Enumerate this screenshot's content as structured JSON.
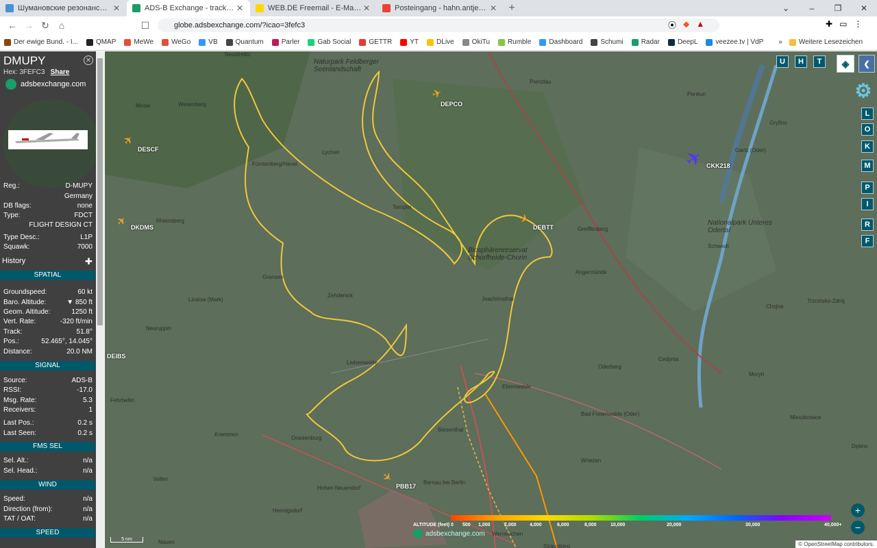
{
  "tabs": [
    {
      "title": "Шумановские резонансы | Space Ob",
      "active": false,
      "fav": "#4a90d9"
    },
    {
      "title": "ADS-B Exchange - tracking 11435",
      "active": true,
      "fav": "#1a9c6b"
    },
    {
      "title": "WEB.DE Freemail - E-Mail made in Ge",
      "active": false,
      "fav": "#ffd700"
    },
    {
      "title": "Posteingang - hahn.antje73@gmail.cc",
      "active": false,
      "fav": "#ea4335"
    }
  ],
  "url": "globe.adsbexchange.com/?icao=3fefc3",
  "bookmarks": [
    {
      "label": "Der ewige Bund. - I...",
      "color": "#8b4513"
    },
    {
      "label": "QMAP",
      "color": "#222"
    },
    {
      "label": "MeWe",
      "color": "#e74c3c"
    },
    {
      "label": "WeGo",
      "color": "#e74c3c"
    },
    {
      "label": "VB",
      "color": "#3399ff"
    },
    {
      "label": "Quantum",
      "color": "#444"
    },
    {
      "label": "Parler",
      "color": "#c2185b"
    },
    {
      "label": "Gab Social",
      "color": "#21cf7a"
    },
    {
      "label": "GETTR",
      "color": "#e53935"
    },
    {
      "label": "YT",
      "color": "#ff0000"
    },
    {
      "label": "DLive",
      "color": "#ffc107"
    },
    {
      "label": "OkiTu",
      "color": "#888"
    },
    {
      "label": "Rumble",
      "color": "#85c742"
    },
    {
      "label": "Dashboard",
      "color": "#3399ff"
    },
    {
      "label": "Schumi",
      "color": "#444"
    },
    {
      "label": "Radar",
      "color": "#1a9c6b"
    },
    {
      "label": "DeepL",
      "color": "#0f2b46"
    },
    {
      "label": "veezee.tv | VdP",
      "color": "#1e88e5"
    }
  ],
  "more_bookmarks": "Weitere Lesezeichen",
  "aircraft": {
    "callsign": "DMUPY",
    "hex_label": "Hex:",
    "hex": "3FEFC3",
    "share": "Share",
    "brand": "adsbexchange.com"
  },
  "info": [
    {
      "k": "Reg.:",
      "v": "D-MUPY"
    },
    {
      "k": "",
      "v": "Germany"
    },
    {
      "k": "DB flags:",
      "v": "none"
    },
    {
      "k": "Type:",
      "v": "FDCT"
    },
    {
      "k": "",
      "v": "FLIGHT DESIGN CT"
    },
    {
      "k": "Type Desc.:",
      "v": "L1P"
    },
    {
      "k": "Squawk:",
      "v": "7000"
    }
  ],
  "history_label": "History",
  "sections": {
    "spatial": {
      "title": "SPATIAL",
      "rows": [
        {
          "k": "Groundspeed:",
          "v": "60 kt"
        },
        {
          "k": "Baro. Altitude:",
          "v": "▼ 850 ft"
        },
        {
          "k": "Geom. Altitude:",
          "v": "1250 ft"
        },
        {
          "k": "Vert. Rate:",
          "v": "-320 ft/min"
        },
        {
          "k": "Track:",
          "v": "51.8°"
        },
        {
          "k": "Pos.:",
          "v": "52.465°, 14.045°"
        },
        {
          "k": "Distance:",
          "v": "20.0 NM"
        }
      ]
    },
    "signal": {
      "title": "SIGNAL",
      "rows": [
        {
          "k": "Source:",
          "v": "ADS-B"
        },
        {
          "k": "RSSI:",
          "v": "-17.0"
        },
        {
          "k": "Msg. Rate:",
          "v": "5.3"
        },
        {
          "k": "Receivers:",
          "v": "1"
        },
        {
          "k": "Last Pos.:",
          "v": "0.2 s"
        },
        {
          "k": "Last Seen:",
          "v": "0.2 s"
        }
      ]
    },
    "fms": {
      "title": "FMS SEL",
      "rows": [
        {
          "k": "Sel. Alt.:",
          "v": "n/a"
        },
        {
          "k": "Sel. Head.:",
          "v": "n/a"
        }
      ]
    },
    "wind": {
      "title": "WIND",
      "rows": [
        {
          "k": "Speed:",
          "v": "n/a"
        },
        {
          "k": "Direction (from):",
          "v": "n/a"
        },
        {
          "k": "TAT / OAT:",
          "v": "n/a"
        }
      ]
    },
    "speed": {
      "title": "SPEED"
    }
  },
  "map_controls_top": [
    "U",
    "H",
    "T"
  ],
  "map_controls_side": [
    "L",
    "O",
    "K",
    "M",
    "P",
    "I",
    "R",
    "F"
  ],
  "planes": [
    {
      "label": "DEPCO",
      "color": "#f5a623"
    },
    {
      "label": "DESCF",
      "color": "#f5a623"
    },
    {
      "label": "DKDMS",
      "color": "#f5a623"
    },
    {
      "label": "DEBTT",
      "color": "#f5a623"
    },
    {
      "label": "CKK218",
      "color": "#5533ff"
    },
    {
      "label": "DEIBS",
      "color": ""
    },
    {
      "label": "PBB17",
      "color": "#f5a623"
    }
  ],
  "map_places": [
    "Naturpark Feldberger Seenlandschaft",
    "Neustrelitz",
    "Wesenberg",
    "Mirow",
    "Lychen",
    "Fürstenberg/Havel",
    "Prenzlau",
    "Penkun",
    "Templin",
    "Rheinsberg",
    "Gransee",
    "Zehdenick",
    "Biosphärenreservat Schorfheide-Chorin",
    "Joachimsthal",
    "Angermünde",
    "Schwedt",
    "Nationalpark Unteres Odertal",
    "Gartz (Oder)",
    "Gryfino",
    "Lindow (Mark)",
    "Neuruppin",
    "Liebenwalde",
    "Eberswalde",
    "Oderberg",
    "Cedynia",
    "Chojna",
    "Trzcińsko-Zdrój",
    "Moryń",
    "Bad Freienwalde (Oder)",
    "Mieszkowice",
    "Dębno",
    "Biesenthal",
    "Wriezen",
    "Oranienburg",
    "Kremmen",
    "Fehrbellin",
    "Velten",
    "Hohen Neuendorf",
    "Bernau bei Berlin",
    "Hennigsdorf",
    "Nauen",
    "Werneuchen",
    "Strausberg",
    "Greiffenberg"
  ],
  "scale": "5 nm",
  "altitude_title": "ALTITUDE (feet)",
  "altitude_ticks": [
    "0",
    "500",
    "1,000",
    "2,000",
    "4,000",
    "6,000",
    "8,000",
    "10,000",
    "20,000",
    "30,000",
    "40,000+"
  ],
  "watermark": "adsbexchange.com",
  "attribution": "© OpenStreetMap contributors."
}
